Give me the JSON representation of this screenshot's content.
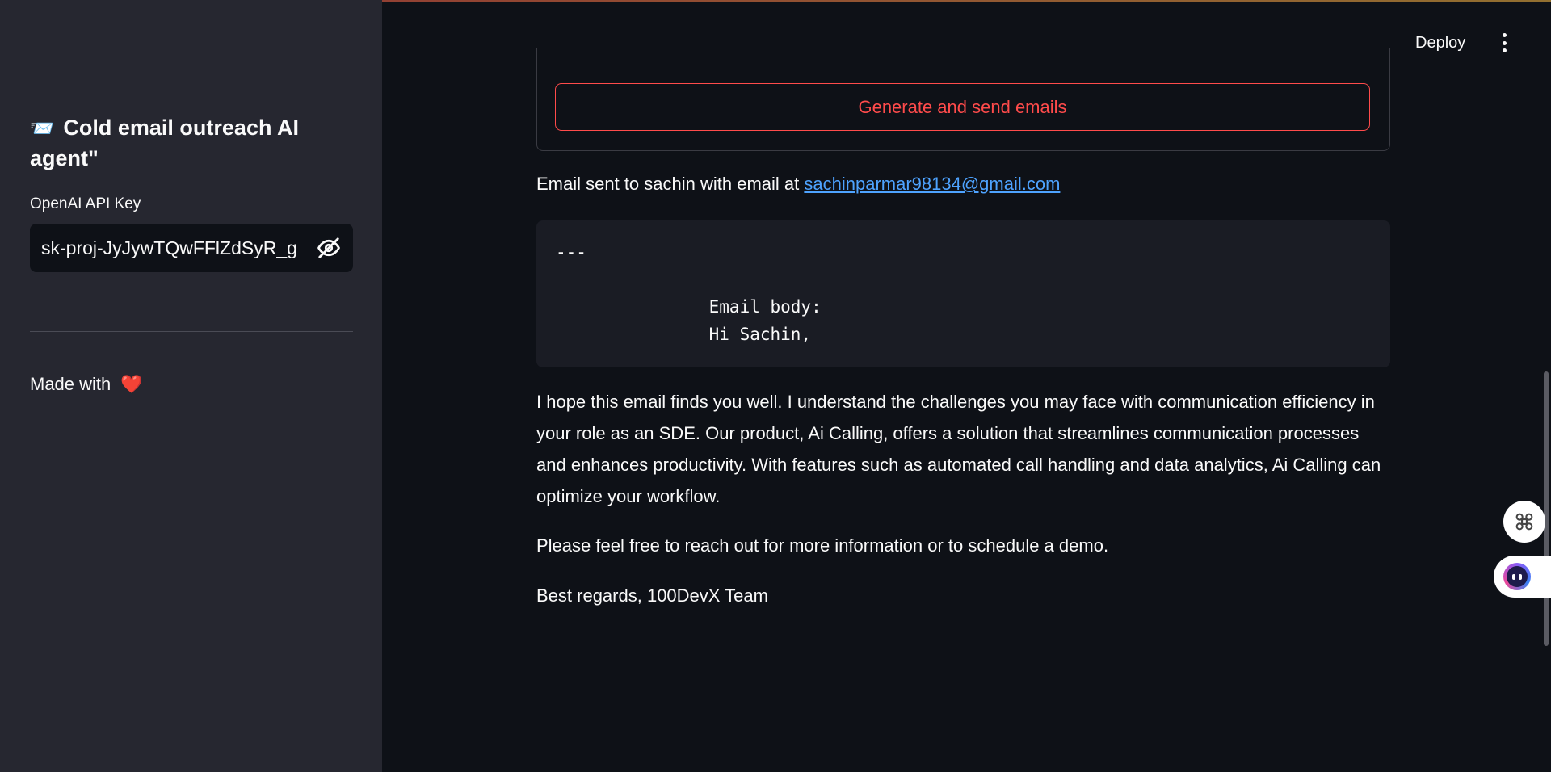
{
  "sidebar": {
    "title_emoji": "📨",
    "title": "Cold email outreach AI agent\"",
    "api_key_label": "OpenAI API Key",
    "api_key_value": "sk-proj-JyJywTQwFFlZdSyR_g",
    "made_with": "Made with",
    "heart": "❤️"
  },
  "header": {
    "deploy_label": "Deploy"
  },
  "main": {
    "generate_button": "Generate and send emails",
    "sent_prefix": "Email sent to sachin with email at ",
    "sent_email": "sachinparmar98134@gmail.com",
    "code_text": "---\n\n               Email body:\n               Hi Sachin,",
    "paragraph_1": "I hope this email finds you well. I understand the challenges you may face with communication efficiency in your role as an SDE. Our product, Ai Calling, offers a solution that streamlines communication processes and enhances productivity. With features such as automated call handling and data analytics, Ai Calling can optimize your workflow.",
    "paragraph_2": "Please feel free to reach out for more information or to schedule a demo.",
    "paragraph_3": "Best regards, 100DevX Team"
  },
  "icons": {
    "password_toggle": "eye-off-icon",
    "menu": "kebab-menu-icon",
    "command": "command-icon",
    "assistant": "bot-icon"
  },
  "colors": {
    "accent": "#ff4b4b",
    "link": "#4ea3ff",
    "sidebar_bg": "#262730",
    "main_bg": "#0e1117"
  }
}
